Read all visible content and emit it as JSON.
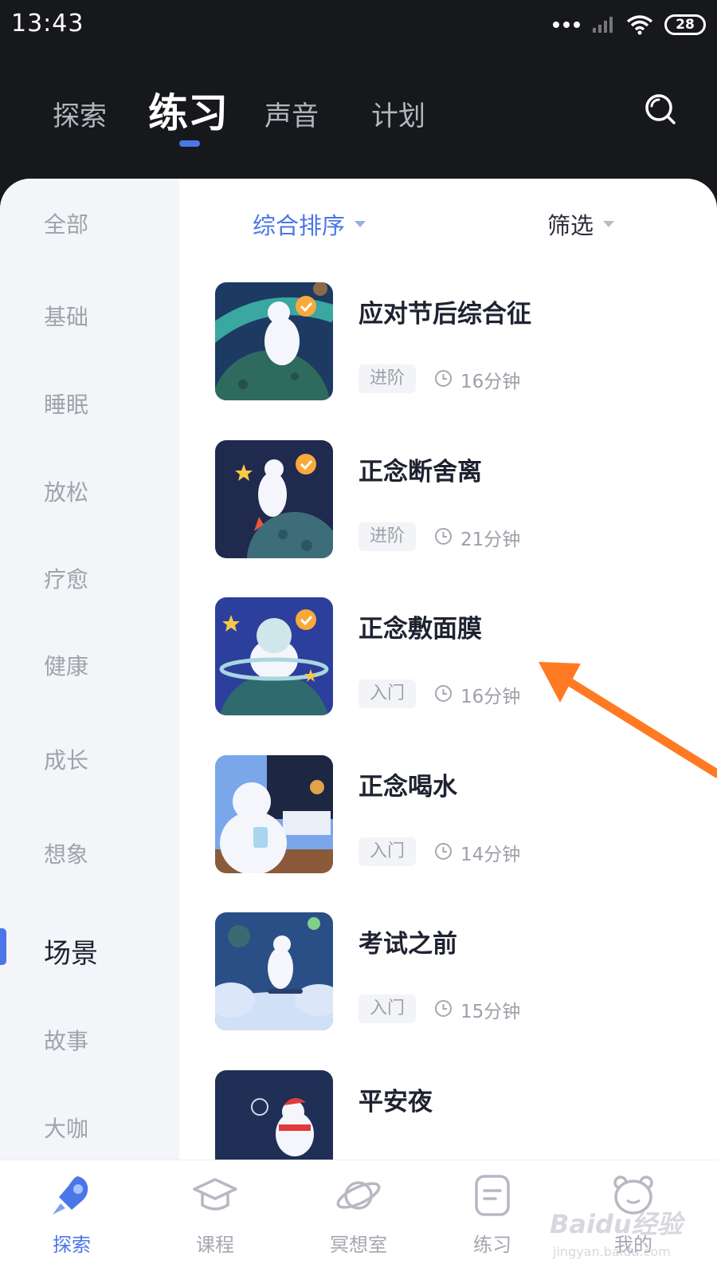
{
  "status_bar": {
    "time": "13:43",
    "battery": "28"
  },
  "top_tabs": [
    {
      "label": "探索",
      "active": false
    },
    {
      "label": "练习",
      "active": true
    },
    {
      "label": "声音",
      "active": false
    },
    {
      "label": "计划",
      "active": false
    }
  ],
  "sidebar": {
    "items": [
      "全部",
      "基础",
      "睡眠",
      "放松",
      "疗愈",
      "健康",
      "成长",
      "想象",
      "场景",
      "故事",
      "大咖"
    ],
    "active_index": 8
  },
  "sort_bar": {
    "sort_label": "综合排序",
    "filter_label": "筛选"
  },
  "practices": [
    {
      "title": "应对节后综合征",
      "level": "进阶",
      "duration": "16分钟",
      "icon": "bear-swing-icon"
    },
    {
      "title": "正念断舍离",
      "level": "进阶",
      "duration": "21分钟",
      "icon": "bear-jetpack-icon"
    },
    {
      "title": "正念敷面膜",
      "level": "入门",
      "duration": "16分钟",
      "icon": "bear-facemask-icon"
    },
    {
      "title": "正念喝水",
      "level": "入门",
      "duration": "14分钟",
      "icon": "bear-drinking-water-icon"
    },
    {
      "title": "考试之前",
      "level": "入门",
      "duration": "15分钟",
      "icon": "bear-clouds-icon"
    },
    {
      "title": "平安夜",
      "level": "",
      "duration": "",
      "icon": "bear-christmas-icon"
    }
  ],
  "bottom_nav": [
    {
      "label": "探索",
      "icon": "rocket-icon",
      "active": true
    },
    {
      "label": "课程",
      "icon": "graduation-cap-icon",
      "active": false
    },
    {
      "label": "冥想室",
      "icon": "planet-icon",
      "active": false
    },
    {
      "label": "练习",
      "icon": "note-icon",
      "active": false
    },
    {
      "label": "我的",
      "icon": "bear-face-icon",
      "active": false
    }
  ],
  "watermark": {
    "main": "Baidu经验",
    "sub": "jingyan.baidu.com"
  },
  "colors": {
    "accent": "#4b76e8",
    "header_bg": "#17181c",
    "arrow": "#ff7a22"
  }
}
